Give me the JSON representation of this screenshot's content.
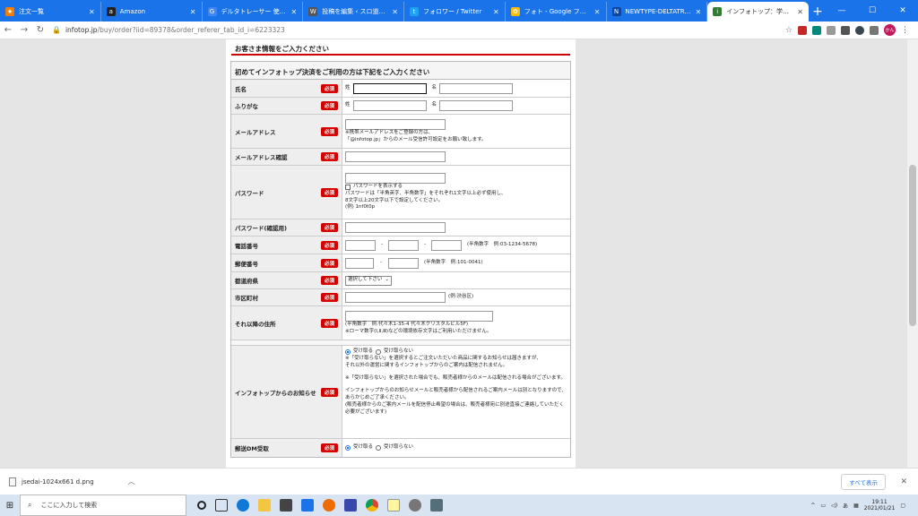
{
  "tabs": [
    {
      "label": "注文一覧",
      "color": "#f57c00"
    },
    {
      "label": "Amazon",
      "color": "#222222"
    },
    {
      "label": "デルタトレーサー 使えない - Goo",
      "color": "#4285f4"
    },
    {
      "label": "投稿を編集 ‹ スロ道！〜ゴロ",
      "color": "#555555"
    },
    {
      "label": "フォロワー / Twitter",
      "color": "#1da1f2"
    },
    {
      "label": "フォト - Google フォト",
      "color": "#fbbc05"
    },
    {
      "label": "NEWTYPE-DELTATRACER /",
      "color": "#0d47a1"
    },
    {
      "label": "インフォトップ：学ぶ・稼ぐ・アフ",
      "color": "#2e7d32"
    }
  ],
  "window_controls": [
    "—",
    "☐",
    "✕"
  ],
  "address": {
    "host": "infotop.jp",
    "path": "/buy/order?iid=89378&order_referer_tab_id_i=6223323",
    "lock": "🔒"
  },
  "profile_label": "かん",
  "page": {
    "section_title": "お客さま情報をご入力ください",
    "form_title": "初めてインフォトップ決済をご利用の方は下記をご入力ください",
    "required_label": "必須",
    "rows": {
      "name": {
        "label": "氏名",
        "sei": "姓",
        "mei": "名"
      },
      "kana": {
        "label": "ふりがな",
        "sei": "姓",
        "mei": "名"
      },
      "email": {
        "label": "メールアドレス",
        "note1": "※携帯メールアドレスをご登録の方は、",
        "note2": "「@infotop.jp」からのメール受信許可設定をお願い致します。"
      },
      "email_confirm": {
        "label": "メールアドレス確認"
      },
      "password": {
        "label": "パスワード",
        "show": "パスワードを表示する",
        "note1": "パスワードは「半角英字、半角数字」をそれぞれ1文字以上必ず使用し、",
        "note2": "8文字以上20文字以下で設定してください。",
        "note3": "(例) 1nf0t0p"
      },
      "password_confirm": {
        "label": "パスワード(確認用)"
      },
      "phone": {
        "label": "電話番号",
        "sep": "-",
        "hint": "(半角数字　例:03-1234-5678)"
      },
      "postal": {
        "label": "郵便番号",
        "sep": "-",
        "hint": "(半角数字　例:101-0041)"
      },
      "prefecture": {
        "label": "都道府県",
        "select": "選択して下さい"
      },
      "city": {
        "label": "市区町村",
        "hint": "(例:渋谷区)"
      },
      "address": {
        "label": "それ以降の住所",
        "note1": "(半角数字　例:代々木1-35-4 代々木クリスタルビル5F)",
        "note2": "※ローマ数字(Ⅰ,Ⅱ,Ⅲ)などの環境依存文字はご利用いただけません。"
      },
      "notice": {
        "label": "インフォトップからのお知らせ",
        "opt1": "受け取る",
        "opt2": "受け取らない",
        "lines": [
          "※「受け取らない」を選択するとご注文いただいた商品に関するお知らせは届きますが、",
          "それ以外の運営に関するインフォトップからのご案内は配信されません。",
          "",
          "※「受け取らない」を選択された場合でも、販売者様からのメールは配信される場合がございます。",
          "",
          "インフォトップからのお知らせメールと販売者様から配信されるご案内メールは別となりますので、あらかじめご了承ください。",
          "(販売者様からのご案内メールを配信停止希望の場合は、販売者様宛に別途直接ご連絡していただく必要がございます)"
        ]
      },
      "dm": {
        "label": "郵送DM受取",
        "opt1": "受け取る",
        "opt2": "受け取らない"
      }
    }
  },
  "downloads": {
    "filename": "jsedai-1024x661 d.png",
    "show_all": "すべて表示"
  },
  "taskbar": {
    "search_placeholder": "ここに入力して検索",
    "time": "19:11",
    "date": "2021/01/21",
    "ime": "あ"
  }
}
